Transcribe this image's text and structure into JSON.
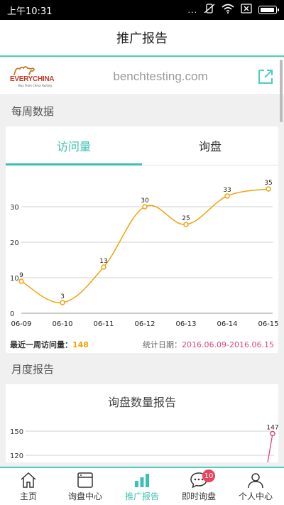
{
  "status_bar": {
    "time": "上午10:31",
    "dots": "..."
  },
  "header": {
    "title": "推广报告"
  },
  "brand": {
    "logo_text": "EVERYCHINA",
    "logo_tagline": "Buy From China Factory",
    "site": "benchtesting.com"
  },
  "weekly": {
    "section_title": "每周数据",
    "tabs": [
      {
        "label": "访问量"
      },
      {
        "label": "询盘"
      }
    ],
    "summary_label": "最近一周访问量：",
    "summary_value": "148",
    "date_label": "统计日期：",
    "date_value": "2016.06.09-2016.06.15"
  },
  "monthly": {
    "section_title": "月度报告",
    "card_title": "询盘数量报告"
  },
  "chart_data": [
    {
      "type": "line",
      "categories": [
        "06-09",
        "06-10",
        "06-11",
        "06-12",
        "06-13",
        "06-14",
        "06-15"
      ],
      "series": [
        {
          "values": [
            9,
            3,
            13,
            30,
            25,
            33,
            35
          ],
          "color": "#f0a30a"
        }
      ],
      "y_ticks": [
        0,
        10,
        20,
        30
      ],
      "ylim": [
        0,
        35
      ],
      "grid": true
    },
    {
      "type": "line",
      "y_ticks": [
        120,
        150
      ],
      "series": [
        {
          "values": [
            147
          ],
          "color": "#e0467a"
        }
      ],
      "note": "partially visible"
    }
  ],
  "bottom_nav": [
    {
      "label": "主页",
      "icon": "home-icon"
    },
    {
      "label": "询盘中心",
      "icon": "inbox-icon"
    },
    {
      "label": "推广报告",
      "icon": "bar-chart-icon",
      "active": true
    },
    {
      "label": "即时询盘",
      "icon": "chat-icon",
      "badge": "10"
    },
    {
      "label": "个人中心",
      "icon": "user-icon"
    }
  ],
  "colors": {
    "accent": "#3cc0b3",
    "line": "#f0a30a",
    "date": "#e0467a",
    "badge": "#e8445a"
  }
}
